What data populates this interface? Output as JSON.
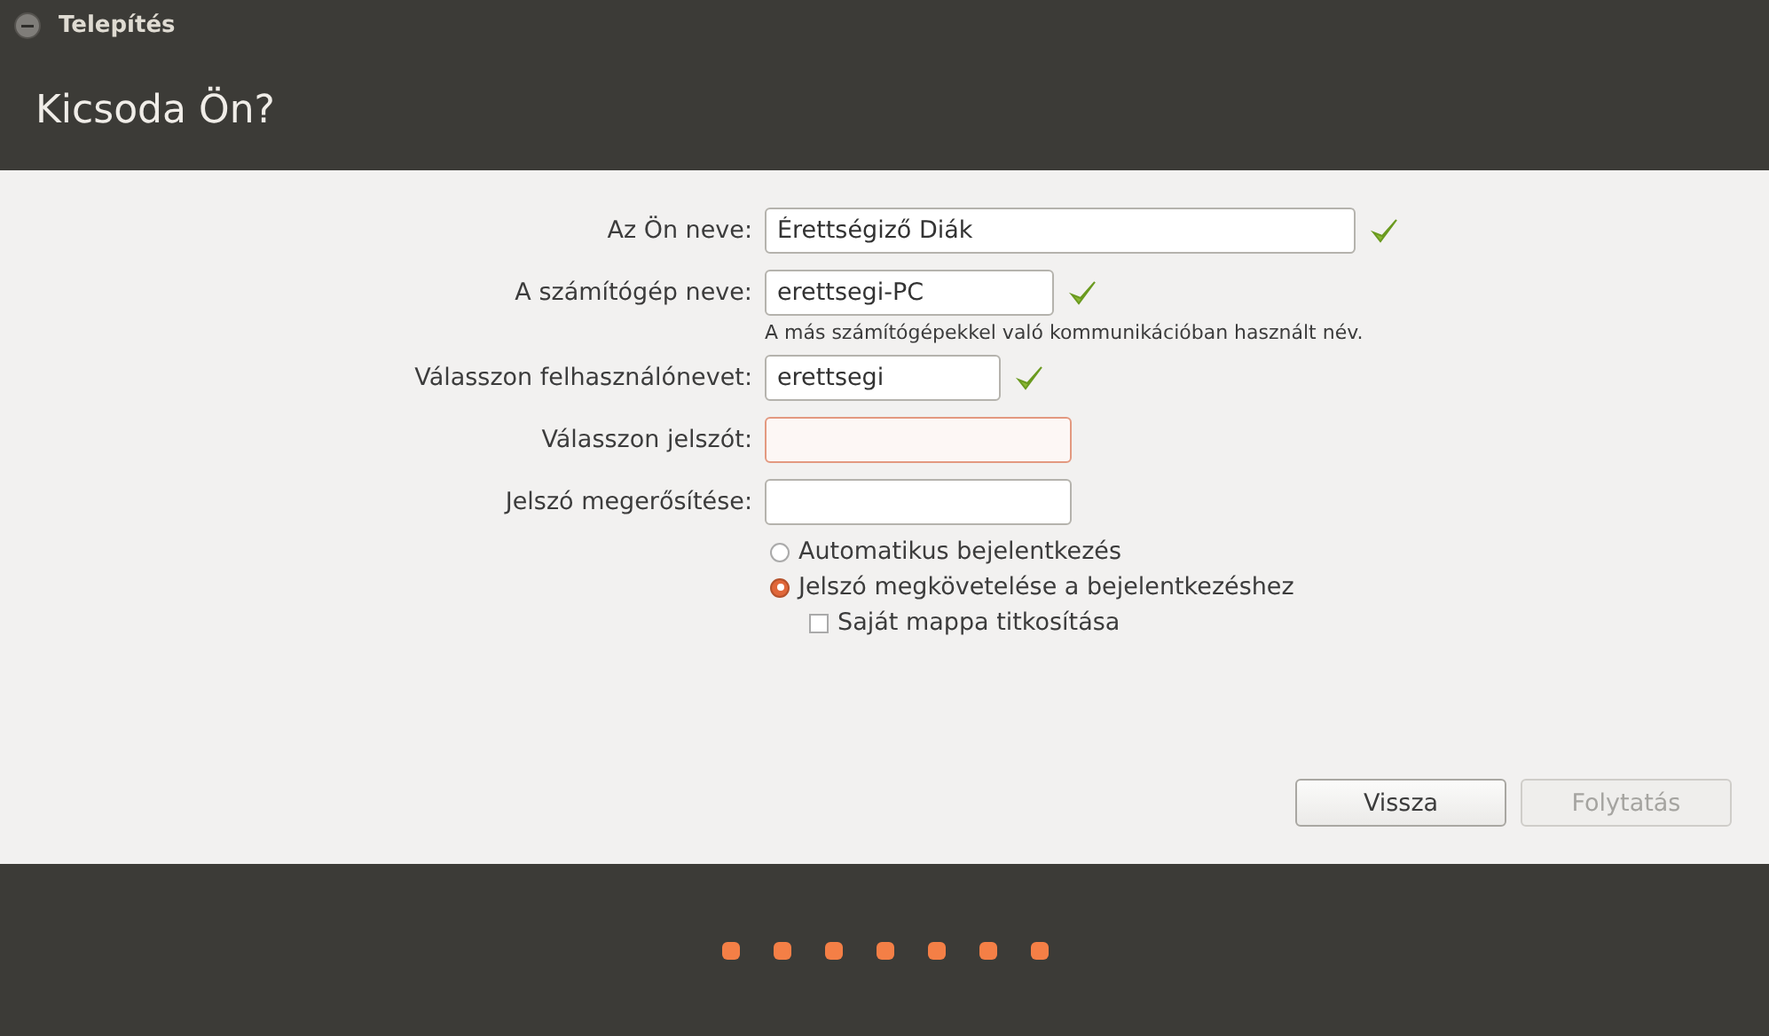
{
  "window": {
    "title": "Telepítés"
  },
  "header": {
    "title": "Kicsoda Ön?"
  },
  "fields": [
    {
      "label": "Az Ön neve:",
      "value": "Érettségiző Diák",
      "valid": true,
      "error": false
    },
    {
      "label": "A számítógép neve:",
      "value": "erettsegi-PC",
      "valid": true,
      "error": false,
      "hint": "A más számítógépekkel való kommunikációban használt név."
    },
    {
      "label": "Válasszon felhasználónevet:",
      "value": "erettsegi",
      "valid": true,
      "error": false
    },
    {
      "label": "Válasszon jelszót:",
      "valid": false,
      "error": true
    },
    {
      "label": "Jelszó megerősítése:",
      "valid": false,
      "error": false
    }
  ],
  "login_options": [
    {
      "label": "Automatikus bejelentkezés",
      "selected": false
    },
    {
      "label": "Jelszó megkövetelése a bejelentkezéshez",
      "selected": true
    }
  ],
  "encrypt": {
    "label": "Saját mappa titkosítása",
    "checked": false
  },
  "buttons": [
    {
      "label": "Vissza",
      "disabled": false
    },
    {
      "label": "Folytatás",
      "disabled": true
    }
  ]
}
